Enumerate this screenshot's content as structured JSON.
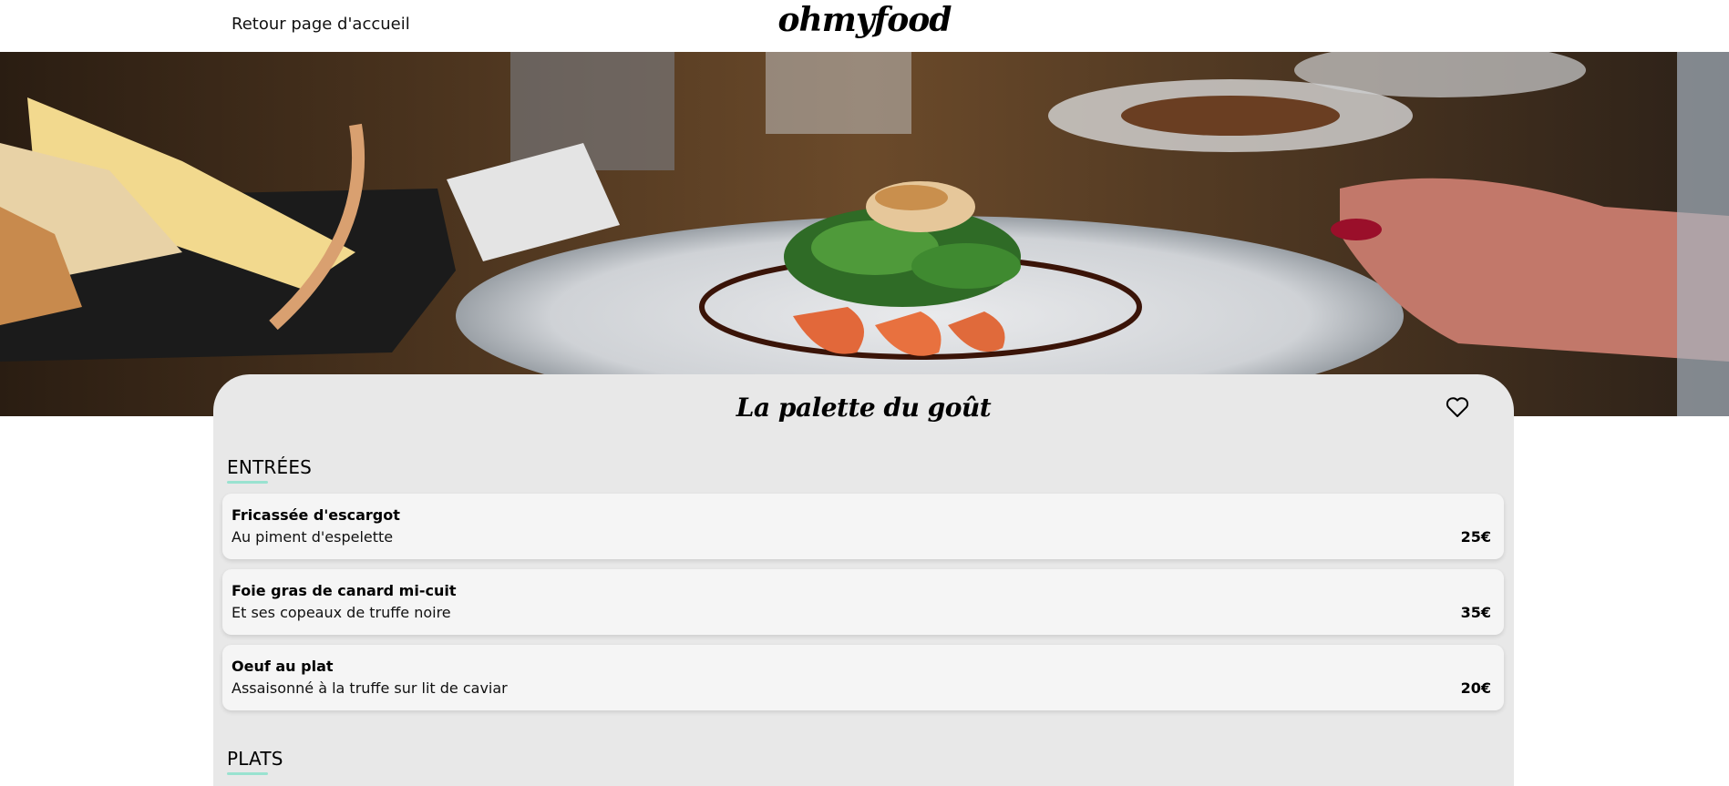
{
  "header": {
    "back_label": "Retour page d'accueil",
    "logo": "ohmyfood"
  },
  "hero": {
    "image": "restaurant-dish-photo"
  },
  "restaurant": {
    "name": "La palette du goût",
    "favorite_icon": "heart-icon"
  },
  "sections": [
    {
      "title": "ENTRÉES",
      "dishes": [
        {
          "name": "Fricassée d'escargot",
          "description": "Au piment d'espelette",
          "price": "25€"
        },
        {
          "name": "Foie gras de canard mi-cuit",
          "description": "Et ses copeaux de truffe noire",
          "price": "35€"
        },
        {
          "name": "Oeuf au plat",
          "description": "Assaisonné à la truffe sur lit de caviar",
          "price": "20€"
        }
      ]
    },
    {
      "title": "PLATS",
      "dishes": []
    }
  ],
  "colors": {
    "accent": "#99e2d0",
    "card_bg": "#e8e8e8",
    "dish_bg": "#f5f5f5"
  }
}
